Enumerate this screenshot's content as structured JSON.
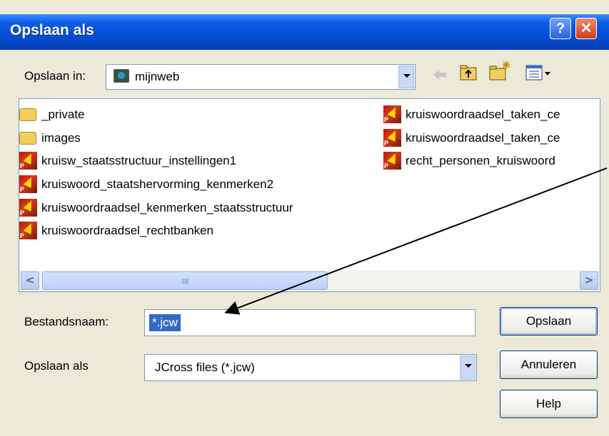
{
  "window": {
    "title": "Opslaan als",
    "help_glyph": "?",
    "close_glyph": "✕"
  },
  "save_in": {
    "label": "Opslaan in:",
    "value": "mijnweb"
  },
  "toolbar_icons": [
    "back-arrow-icon",
    "up-folder-icon",
    "new-folder-icon",
    "view-menu-icon"
  ],
  "files": {
    "col1": [
      {
        "name": "_private",
        "type": "folder"
      },
      {
        "name": "images",
        "type": "folder"
      },
      {
        "name": "kruisw_staatsstructuur_instellingen1",
        "type": "jcw"
      },
      {
        "name": "kruiswoord_staatshervorming_kenmerken2",
        "type": "jcw"
      },
      {
        "name": "kruiswoordraadsel_kenmerken_staatsstructuur",
        "type": "jcw"
      },
      {
        "name": "kruiswoordraadsel_rechtbanken",
        "type": "jcw"
      }
    ],
    "col2": [
      {
        "name": "kruiswoordraadsel_taken_ce",
        "type": "jcw"
      },
      {
        "name": "kruiswoordraadsel_taken_ce",
        "type": "jcw"
      },
      {
        "name": "recht_personen_kruiswoord",
        "type": "jcw"
      }
    ]
  },
  "scroll": {
    "left": "<",
    "right": ">"
  },
  "filename": {
    "label": "Bestandsnaam:",
    "value": "*.jcw"
  },
  "filetype": {
    "label": "Opslaan als",
    "value": "JCross files (*.jcw)"
  },
  "buttons": {
    "save": "Opslaan",
    "cancel": "Annuleren",
    "help": "Help"
  }
}
